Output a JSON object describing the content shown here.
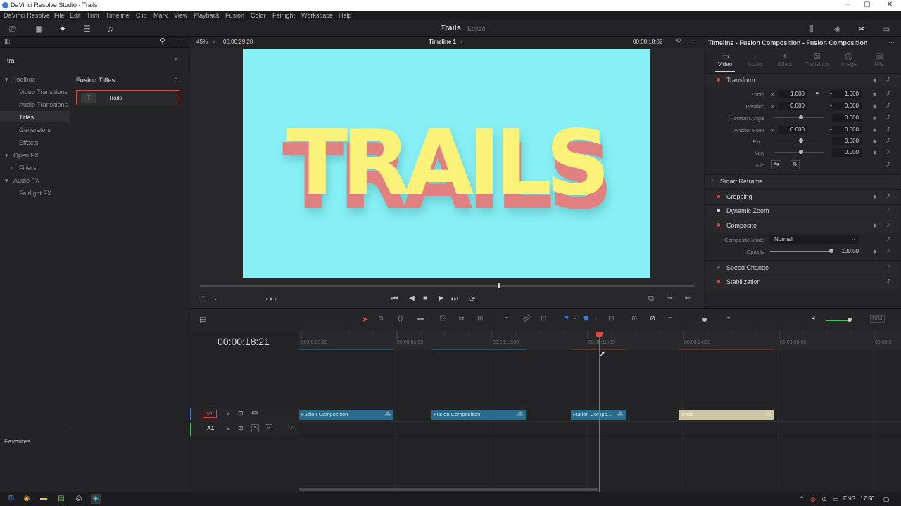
{
  "window": {
    "title": "DaVinci Resolve Studio - Trails",
    "minimize": "─",
    "maximize": "▢",
    "close": "✕"
  },
  "menu": [
    "DaVinci Resolve",
    "File",
    "Edit",
    "Trim",
    "Timeline",
    "Clip",
    "Mark",
    "View",
    "Playback",
    "Fusion",
    "Color",
    "Fairlight",
    "Workspace",
    "Help"
  ],
  "project": {
    "title": "Trails",
    "status": "Edited"
  },
  "viewer": {
    "zoom": "45%",
    "duration": "00:00:29:20",
    "timeline_name": "Timeline 1",
    "timecode": "00:00:18:02",
    "title_text": "TRAILS"
  },
  "search": {
    "value": "tra",
    "clear": "×"
  },
  "tree": {
    "items": [
      {
        "label": "Toolbox",
        "caret": "▾"
      },
      {
        "label": "Video Transitions"
      },
      {
        "label": "Audio Transitions"
      },
      {
        "label": "Titles"
      },
      {
        "label": "Generators"
      },
      {
        "label": "Effects"
      },
      {
        "label": "Open FX",
        "caret": "▾"
      },
      {
        "label": "Filters",
        "caret": "›"
      },
      {
        "label": "Audio FX",
        "caret": "▾"
      },
      {
        "label": "Fairlight FX"
      }
    ],
    "favorites": "Favorites"
  },
  "fusion_titles": {
    "header": "Fusion Titles",
    "item": "Trails",
    "thumb": "T",
    "collapse": "^"
  },
  "inspector": {
    "title": "Timeline - Fusion Composition - Fusion Composition",
    "tabs": [
      "Video",
      "Audio",
      "Effect",
      "Transition",
      "Image",
      "File"
    ],
    "sections": {
      "transform": "Transform",
      "smart_reframe": "Smart Reframe",
      "cropping": "Cropping",
      "dynamic_zoom": "Dynamic Zoom",
      "composite": "Composite",
      "speed_change": "Speed Change",
      "stabilization": "Stabilization"
    },
    "params": {
      "zoom": {
        "label": "Zoom",
        "x": "1.000",
        "y": "1.000"
      },
      "position": {
        "label": "Position",
        "x": "0.000",
        "y": "0.000"
      },
      "rotation": {
        "label": "Rotation Angle",
        "value": "0.000"
      },
      "anchor": {
        "label": "Anchor Point",
        "x": "0.000",
        "y": "0.000"
      },
      "pitch": {
        "label": "Pitch",
        "value": "0.000"
      },
      "yaw": {
        "label": "Yaw",
        "value": "0.000"
      },
      "flip": {
        "label": "Flip"
      },
      "composite_mode": {
        "label": "Composite Mode",
        "value": "Normal"
      },
      "opacity": {
        "label": "Opacity",
        "value": "100.00"
      }
    },
    "axis_x": "X",
    "axis_y": "Y"
  },
  "timeline": {
    "timecode": "00:00:18:21",
    "ruler": [
      "00:00:00:00",
      "00:00:06:00",
      "00:00:12:00",
      "00:00:18:00",
      "00:00:24:00",
      "00:00:30:00",
      "00:00:3"
    ],
    "tracks": {
      "v1": "V1",
      "a1": "A1",
      "a1_channels": "2.0",
      "solo": "S",
      "mute": "M"
    },
    "clips": [
      {
        "label": "Fusion Composition"
      },
      {
        "label": "Fusion Composition"
      },
      {
        "label": "Fusion Compo..."
      },
      {
        "label": "Trails"
      }
    ]
  },
  "taskbar": {
    "lang": "ENG",
    "time": "17:50"
  }
}
